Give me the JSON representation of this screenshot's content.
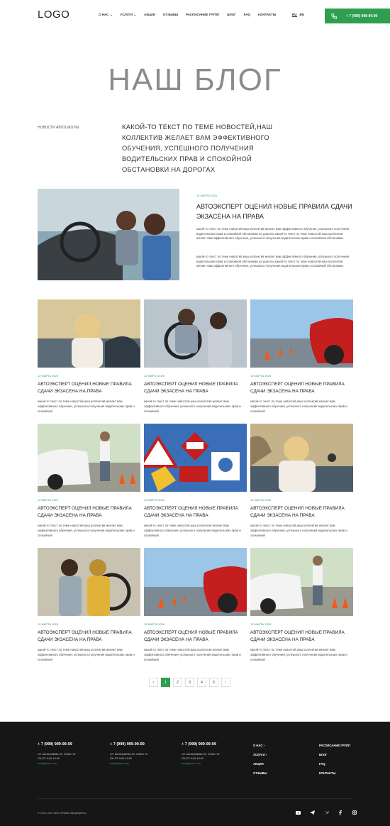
{
  "header": {
    "logo": "LOGO",
    "nav": [
      "О нас ⌄",
      "Услуги ⌄",
      "Акции",
      "Отзывы",
      "Расписание групп",
      "Блог",
      "FAQ",
      "Контакты"
    ],
    "lang": [
      "RU",
      "EN"
    ],
    "phone": "+ 7 (999) 999-99-99"
  },
  "hero": {
    "title": "НАШ БЛОГ"
  },
  "intro": {
    "label": "НОВОСТИ АВТОШКОЛЫ",
    "text": "КАКОЙ-ТО ТЕКСТ ПО ТЕМЕ НОВОСТЕЙ,НАШ КОЛЛЕКТИВ ЖЕЛАЕТ ВАМ ЭФФЕКТИВНОГО ОБУЧЕНИЯ, УСПЕШНОГО ПОЛУЧЕНИЯ ВОДИТЕЛЬСКИХ ПРАВ И СПОКОЙНОЙ ОБСТАНОВКИ НА ДОРОГАХ"
  },
  "featured": {
    "date": "12 МАРТА 2020",
    "title": "АВТОЭКСПЕРТ ОЦЕНИЛ НОВЫЕ ПРАВИЛА СДАЧИ ЭКЗАСЕНА НА ПРАВА",
    "p1": "какой-то текст по теме новостей,наш коллектив желает вам эффективного обучения, успешного получения водительских прав и спокойной обстановки на дорогах какой-то текст по теме новостей,наш коллектив желает вам эффективного обучения, успешного получения водительских прав и спокойной обстановки.",
    "p2": "какой-то текст по теме новостей,наш коллектив желает вам эффективного обучения, успешного получения водительских прав и спокойной обстановки на дорогах какой-то текст по теме новостей,наш коллектив желает вам эффективного обучения, успешного получения водительских прав и спокойной обстановки."
  },
  "posts": [
    {
      "date": "12 МАРТА 2020",
      "title": "АВТОЭКСПЕРТ ОЦЕНИЛ НОВЫЕ ПРАВИЛА СДАЧИ ЭКЗАСЕНА НА ПРАВА",
      "excerpt": "какой-то текст по теме новостей,наш коллектив желает вам эффективного обучения, успешного получения водительских прав и спокойной",
      "img": "woman-car"
    },
    {
      "date": "12 МАРТА 2020",
      "title": "АВТОЭКСПЕРТ ОЦЕНИЛ НОВЫЕ ПРАВИЛА СДАЧИ ЭКЗАСЕНА НА ПРАВА",
      "excerpt": "какой-то текст по теме новостей,наш коллектив желает вам эффективного обучения, успешного получения водительских прав и спокойной",
      "img": "driving-lesson"
    },
    {
      "date": "12 МАРТА 2020",
      "title": "АВТОЭКСПЕРТ ОЦЕНИЛ НОВЫЕ ПРАВИЛА СДАЧИ ЭКЗАСЕНА НА ПРАВА",
      "excerpt": "какой-то текст по теме новостей,наш коллектив желает вам эффективного обучения, успешного получения водительских прав и спокойной",
      "img": "red-car-cones"
    },
    {
      "date": "12 МАРТА 2020",
      "title": "АВТОЭКСПЕРТ ОЦЕНИЛ НОВЫЕ ПРАВИЛА СДАЧИ ЭКЗАСЕНА НА ПРАВА",
      "excerpt": "какой-то текст по теме новостей,наш коллектив желает вам эффективного обучения, успешного получения водительских прав и спокойной",
      "img": "white-car-instructor"
    },
    {
      "date": "12 МАРТА 2020",
      "title": "АВТОЭКСПЕРТ ОЦЕНИЛ НОВЫЕ ПРАВИЛА СДАЧИ ЭКЗАСЕНА НА ПРАВА",
      "excerpt": "какой-то текст по теме новостей,наш коллектив желает вам эффективного обучения, успешного получения водительских прав и спокойной",
      "img": "road-signs"
    },
    {
      "date": "12 МАРТА 2020",
      "title": "АВТОЭКСПЕРТ ОЦЕНИЛ НОВЫЕ ПРАВИЛА СДАЧИ ЭКЗАСЕНА НА ПРАВА",
      "excerpt": "какой-то текст по теме новостей,наш коллектив желает вам эффективного обучения, успешного получения водительских прав и спокойной",
      "img": "woman-keys"
    },
    {
      "date": "12 МАРТА 2020",
      "title": "АВТОЭКСПЕРТ ОЦЕНИЛ НОВЫЕ ПРАВИЛА СДАЧИ ЭКЗАСЕНА НА ПРАВА",
      "excerpt": "какой-то текст по теме новостей,наш коллектив желает вам эффективного обучения, успешного получения водительских прав и спокойной",
      "img": "driving-lesson-2"
    },
    {
      "date": "12 МАРТА 2020",
      "title": "АВТОЭКСПЕРТ ОЦЕНИЛ НОВЫЕ ПРАВИЛА СДАЧИ ЭКЗАСЕНА НА ПРАВА",
      "excerpt": "какой-то текст по теме новостей,наш коллектив желает вам эффективного обучения, успешного получения водительских прав и спокойной",
      "img": "red-car-cones"
    },
    {
      "date": "12 МАРТА 2020",
      "title": "АВТОЭКСПЕРТ ОЦЕНИЛ НОВЫЕ ПРАВИЛА СДАЧИ ЭКЗАСЕНА НА ПРАВА",
      "excerpt": "какой-то текст по теме новостей,наш коллектив желает вам эффективного обучения, успешного получения водительских прав и спокойной",
      "img": "white-car-instructor"
    }
  ],
  "pagination": {
    "prev": "‹",
    "pages": [
      "1",
      "2",
      "3",
      "4",
      "5"
    ],
    "next": "›",
    "active": "1"
  },
  "footer": {
    "contacts": [
      {
        "phone": "+ 7 (999) 999-99-99",
        "addr1": "УЛ. МАЛЫШЕВА 30, ОФИС 12",
        "addr2": "ПН-ПТ 9:00-19:00",
        "email": "info@gmail.com"
      },
      {
        "phone": "+ 7 (999) 999-99-99",
        "addr1": "УЛ. МАЛЫШЕВА 30, ОФИС 12",
        "addr2": "ПН-ПТ 9:00-19:00",
        "email": "info@gmail.com"
      },
      {
        "phone": "+ 7 (999) 999-99-99",
        "addr1": "УЛ. МАЛЫШЕВА 30, ОФИС 12",
        "addr2": "ПН-ПТ 9:00-19:00",
        "email": "info@gmail.com"
      }
    ],
    "menu1": [
      "О НАС ›",
      "УСЛУГИ ›",
      "АКЦИИ",
      "ОТЗЫВЫ"
    ],
    "menu2": [
      "РАСПИСАНИЕ ГРУПП",
      "БЛОГ",
      "FAQ",
      "КОНТАКТЫ"
    ],
    "copyright": "© 2001-2021 ВСЕ ПРАВА ЗАЩИЩЕНЫ",
    "social": [
      "youtube-icon",
      "telegram-icon",
      "twitter-icon",
      "facebook-icon",
      "instagram-icon"
    ]
  },
  "colors": {
    "accent": "#2e9e4f",
    "footer": "#161616"
  }
}
